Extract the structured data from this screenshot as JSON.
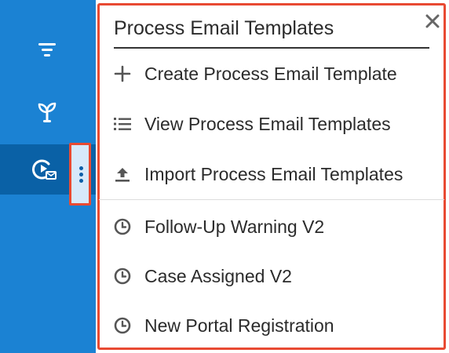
{
  "sidebar": {
    "items": [
      {
        "icon": "filter-icon"
      },
      {
        "icon": "sprout-icon"
      },
      {
        "icon": "process-email-icon",
        "active": true
      }
    ],
    "kebab_icon": "vertical-ellipsis-icon"
  },
  "menu": {
    "title": "Process Email Templates",
    "close_icon": "close-icon",
    "actions": [
      {
        "icon": "plus-icon",
        "label": "Create Process Email Template"
      },
      {
        "icon": "list-icon",
        "label": "View Process Email Templates"
      },
      {
        "icon": "upload-icon",
        "label": "Import Process Email Templates"
      }
    ],
    "recent": [
      {
        "icon": "clock-icon",
        "label": "Follow-Up Warning V2"
      },
      {
        "icon": "clock-icon",
        "label": "Case Assigned V2"
      },
      {
        "icon": "clock-icon",
        "label": "New Portal Registration"
      }
    ]
  },
  "colors": {
    "sidebar": "#1b82d3",
    "sidebar_active": "#0a61a6",
    "highlight_border": "#e84a32"
  }
}
